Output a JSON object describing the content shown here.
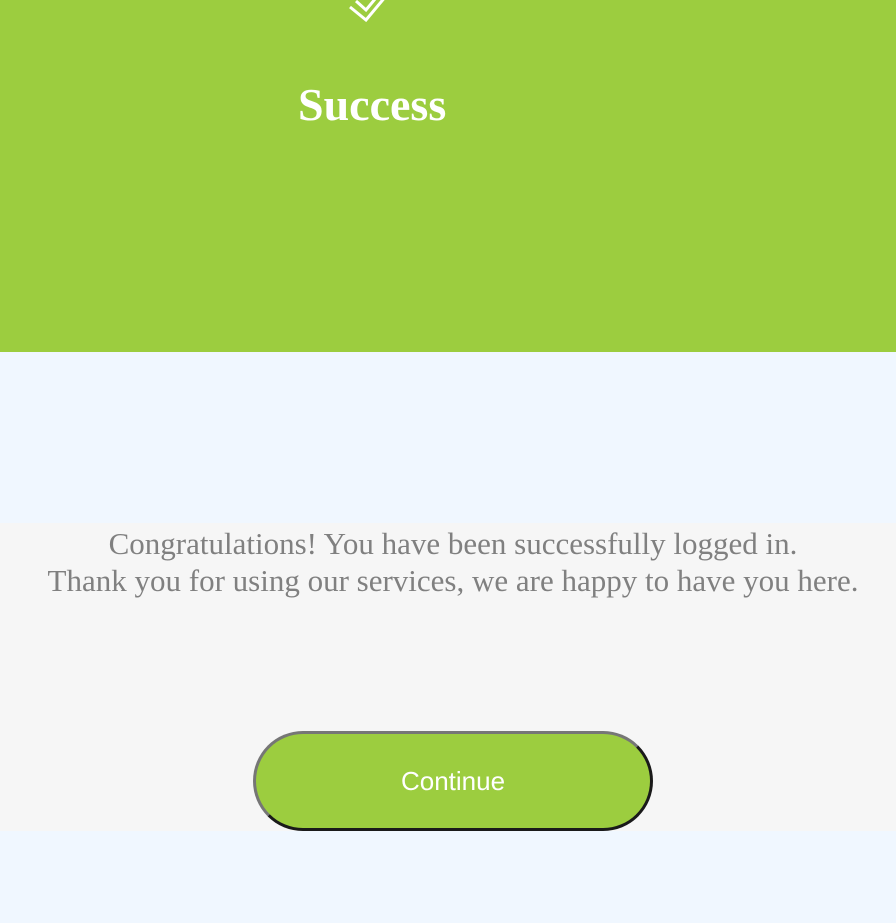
{
  "header": {
    "icon": "double-check-icon",
    "title": "Success",
    "background_color": "#9ccd3f"
  },
  "message": {
    "line1": "Congratulations! You have been successfully logged in.",
    "line2": "Thank you for using our services, we are happy to have you here."
  },
  "actions": {
    "continue_label": "Continue"
  },
  "colors": {
    "accent": "#9ccd3f",
    "page_background": "#f0f7ff",
    "panel_background": "#f6f6f6",
    "message_text": "#808080"
  }
}
